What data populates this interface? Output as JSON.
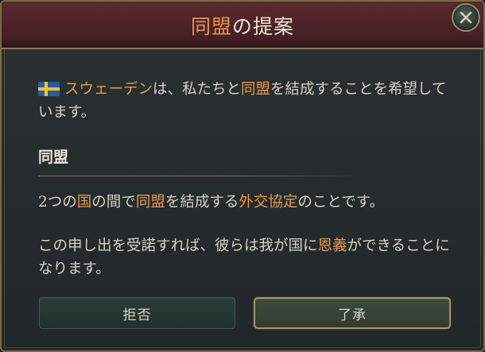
{
  "header": {
    "title_accent": "同盟",
    "title_rest": "の提案"
  },
  "message": {
    "country": "スウェーデン",
    "text_before": "は、私たちと",
    "link_alliance": "同盟",
    "text_after": "を結成することを希望しています。"
  },
  "section": {
    "title": "同盟"
  },
  "definition": {
    "number": "2つの",
    "country_word": "国",
    "between": "の間で",
    "alliance_word": "同盟",
    "middle": "を結成する",
    "agreement_word": "外交協定",
    "end": "のことです。"
  },
  "consequence": {
    "before": "この申し出を受諾すれば、彼らは我が国に",
    "favor_word": "恩義",
    "after": "ができることになります。"
  },
  "buttons": {
    "reject": "拒否",
    "accept": "了承"
  },
  "colors": {
    "highlight": "#e39a4e",
    "header_bg": "#4a2127",
    "panel_bg": "#2b3133",
    "border_gold": "#8a7a55"
  },
  "icons": {
    "flag": "sweden-flag-icon",
    "close": "close-icon"
  }
}
